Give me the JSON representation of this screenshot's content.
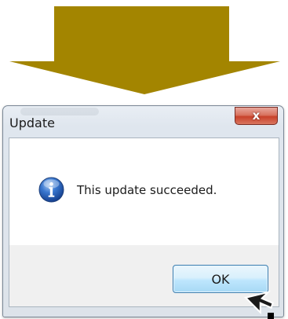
{
  "instruction_arrow": {
    "color": "#a38500",
    "direction": "down"
  },
  "dialog": {
    "title": "Update",
    "close_label": "x",
    "icon": "information-icon",
    "message": "This update succeeded.",
    "ok_label": "OK"
  },
  "cursor": {
    "icon": "mouse-pointer-icon"
  }
}
